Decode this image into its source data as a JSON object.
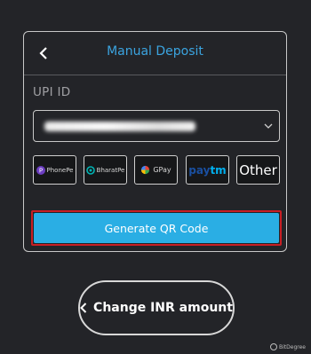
{
  "dialog": {
    "title": "Manual Deposit",
    "upi_label": "UPI ID"
  },
  "payment_apps": [
    {
      "name": "PhonePe"
    },
    {
      "name": "BharatPe"
    },
    {
      "name": "GPay"
    },
    {
      "name": "paytm"
    },
    {
      "name": "Other"
    }
  ],
  "buttons": {
    "generate_qr": "Generate QR Code",
    "change_amount": "Change INR amount"
  },
  "watermark": "BitDegree",
  "colors": {
    "background": "#232428",
    "accent": "#3ba4e0",
    "primary_button": "#2aaee4",
    "highlight_border": "#c81e24"
  }
}
